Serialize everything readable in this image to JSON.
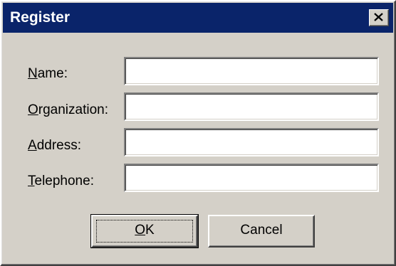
{
  "window": {
    "title": "Register",
    "close_icon": "close-icon"
  },
  "form": {
    "fields": [
      {
        "label": "Name:",
        "mnemonic": "N",
        "rest": "ame:",
        "value": ""
      },
      {
        "label": "Organization:",
        "mnemonic": "O",
        "rest": "rganization:",
        "value": ""
      },
      {
        "label": "Address:",
        "mnemonic": "A",
        "rest": "ddress:",
        "value": ""
      },
      {
        "label": "Telephone:",
        "mnemonic": "T",
        "rest": "elephone:",
        "value": ""
      }
    ]
  },
  "buttons": {
    "ok": {
      "label": "OK",
      "mnemonic": "O",
      "rest": "K"
    },
    "cancel": {
      "label": "Cancel"
    }
  },
  "colors": {
    "titlebar": "#0a246a",
    "face": "#d4d0c8"
  }
}
